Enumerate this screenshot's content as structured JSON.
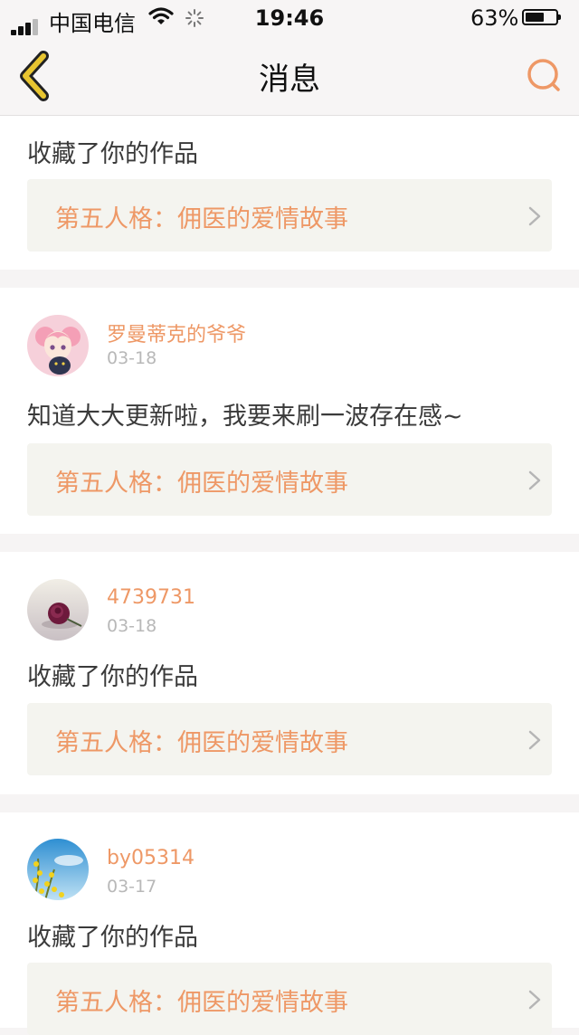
{
  "status_bar": {
    "carrier": "中国电信",
    "time": "19:46",
    "battery_percent": "63%",
    "battery_level": 0.63,
    "icons": [
      "signal-icon",
      "wifi-icon",
      "loading-spinner-icon",
      "battery-icon"
    ]
  },
  "nav": {
    "title": "消息",
    "back_icon": "chevron-left-icon",
    "search_icon": "search-icon"
  },
  "colors": {
    "accent": "#ee9866",
    "back_arrow": "#e8c530",
    "card_link_bg": "#f4f4ef",
    "separator": "#f6f4f4"
  },
  "messages": [
    {
      "username": "",
      "date": "",
      "text": "收藏了你的作品",
      "work_title": "第五人格：佣医的爱情故事"
    },
    {
      "username": "罗曼蒂克的爷爷",
      "date": "03-18",
      "text": "知道大大更新啦，我要来刷一波存在感~",
      "work_title": "第五人格：佣医的爱情故事"
    },
    {
      "username": "4739731",
      "date": "03-18",
      "text": "收藏了你的作品",
      "work_title": "第五人格：佣医的爱情故事"
    },
    {
      "username": "by05314",
      "date": "03-17",
      "text": "收藏了你的作品",
      "work_title": "第五人格：佣医的爱情故事"
    }
  ]
}
